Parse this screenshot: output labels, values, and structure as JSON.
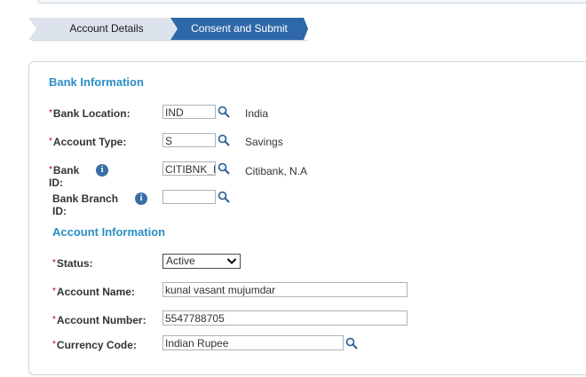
{
  "train": {
    "step1_label": "Account Details",
    "step2_label": "Consent and Submit"
  },
  "bank_info": {
    "title": "Bank Information",
    "location": {
      "label": "Bank Location:",
      "value": "IND",
      "description": "India"
    },
    "account_type": {
      "label": "Account Type:",
      "value": "S",
      "description": "Savings"
    },
    "bank_id": {
      "label_line1": "Bank",
      "label_line2": "ID:",
      "value": "CITIBNK_I",
      "description": "Citibank, N.A"
    },
    "branch_id": {
      "label_line1": "Bank Branch",
      "label_line2": "ID:",
      "value": ""
    }
  },
  "account_info": {
    "title": "Account Information",
    "status": {
      "label": "Status:",
      "selected": "Active"
    },
    "account_name": {
      "label": "Account Name:",
      "value": "kunal vasant mujumdar"
    },
    "account_number": {
      "label": "Account Number:",
      "value": "5547788705"
    },
    "currency_code": {
      "label": "Currency Code:",
      "value": "Indian Rupee"
    }
  },
  "colors": {
    "accent": "#2b8ec3",
    "active_step": "#2f68a8",
    "required": "#c00000"
  },
  "icons": {
    "lookup": "magnifier-icon",
    "info": "info-icon",
    "dropdown": "chevron-down-icon"
  }
}
